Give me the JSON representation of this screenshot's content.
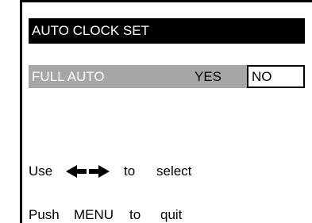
{
  "menu": {
    "title": "AUTO CLOCK SET",
    "setting": {
      "label": "FULL AUTO",
      "options": [
        "YES",
        "NO"
      ],
      "selected": "YES"
    }
  },
  "hints": {
    "use": {
      "word": "Use",
      "icons": [
        "arrow-left-icon",
        "arrow-right-icon"
      ],
      "to": "to",
      "action": "select"
    },
    "quit": {
      "word": "Push",
      "key": "MENU",
      "to": "to",
      "action": "quit"
    }
  },
  "colors": {
    "title_bg": "#000000",
    "highlight": "#a6a6a6",
    "text_light": "#ffffff",
    "text_dark": "#000000"
  }
}
